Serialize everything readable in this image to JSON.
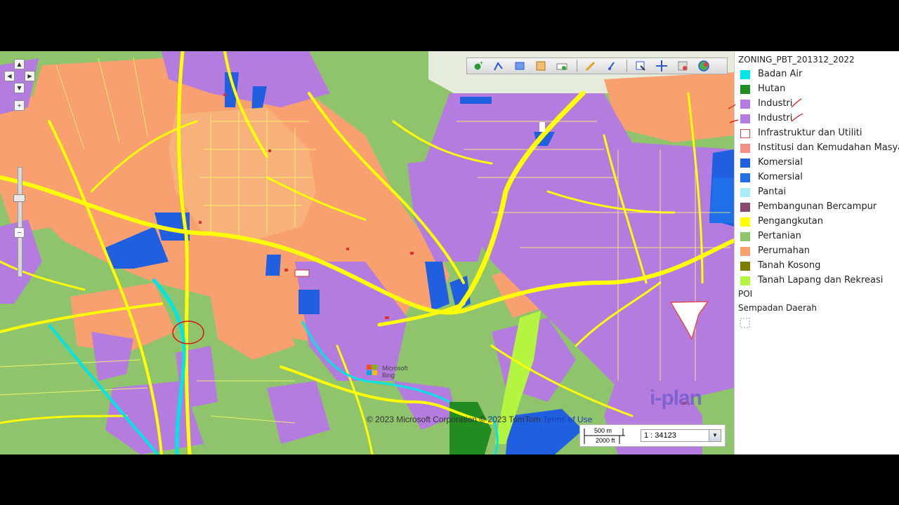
{
  "legend": {
    "title": "ZONING_PBT_201312_2022",
    "items": [
      {
        "label": "Badan Air",
        "color": "#00e5e5"
      },
      {
        "label": "Hutan",
        "color": "#228b22"
      },
      {
        "label": "Industri",
        "color": "#b57ce0"
      },
      {
        "label": "Industri",
        "color": "#b57ce0"
      },
      {
        "label": "Infrastruktur dan Utiliti",
        "color": "#ffffff",
        "border": "#d94848"
      },
      {
        "label": "Institusi dan Kemudahan Masyarakat",
        "color": "#f48f86"
      },
      {
        "label": "Komersial",
        "color": "#1f5fe0"
      },
      {
        "label": "Komersial",
        "color": "#1f6fe8"
      },
      {
        "label": "Pantai",
        "color": "#a9ecf5"
      },
      {
        "label": "Pembangunan Bercampur",
        "color": "#8a4a6e"
      },
      {
        "label": "Pengangkutan",
        "color": "#ffff00"
      },
      {
        "label": "Pertanian",
        "color": "#8fc46c"
      },
      {
        "label": "Perumahan",
        "color": "#f8a070"
      },
      {
        "label": "Tanah Kosong",
        "color": "#7d7d00"
      },
      {
        "label": "Tanah Lapang dan Rekreasi",
        "color": "#b4f542"
      }
    ],
    "poi_label": "POI",
    "boundary_label": "Sempadan Daerah"
  },
  "scale": {
    "metric": "500 m",
    "imperial": "2000 ft",
    "ratio": "1 : 34123"
  },
  "copyright": {
    "text": "© 2023 Microsoft Corporation © 2023 TomTom",
    "terms": "Terms of Use"
  },
  "ms_logo": {
    "line1": "Microsoft",
    "line2": "Bing"
  },
  "iplan_logo": "i-plan",
  "toolbar": {
    "icons": [
      "add-point-icon",
      "add-line-icon",
      "add-polygon-icon",
      "layer-edit-icon",
      "clear-icon",
      "pen-icon",
      "measure-icon",
      "select-icon",
      "pan-icon",
      "zoom-extent-icon",
      "globe-icon"
    ]
  },
  "colors": {
    "agri": "#8fc46c",
    "residential": "#f8a070",
    "industrial": "#b57ce0",
    "commercial": "#1f5fe0",
    "road": "#ffff00",
    "water": "#00e5e5",
    "forest": "#228b22",
    "recreation": "#b4f542"
  }
}
